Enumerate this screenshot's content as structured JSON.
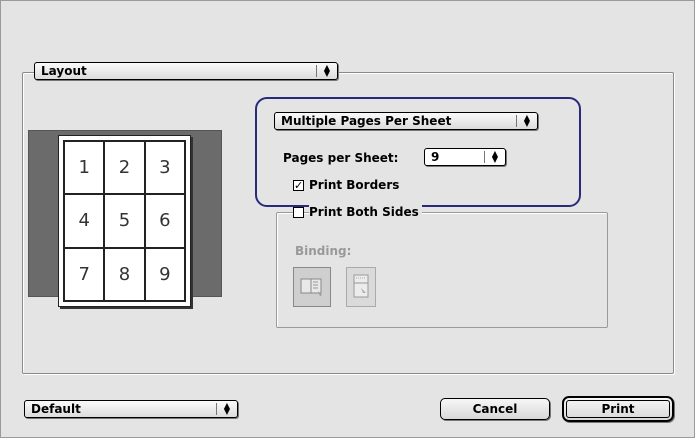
{
  "layout_popup": {
    "label": "Layout"
  },
  "preview": {
    "cells": [
      "1",
      "2",
      "3",
      "4",
      "5",
      "6",
      "7",
      "8",
      "9"
    ]
  },
  "multipage_popup": {
    "label": "Multiple Pages Per Sheet"
  },
  "pages_per_sheet": {
    "label": "Pages per Sheet:",
    "value": "9"
  },
  "print_borders": {
    "label": "Print Borders",
    "checked": true,
    "check_glyph": "✓"
  },
  "print_both_sides": {
    "label": "Print Both Sides",
    "checked": false
  },
  "binding": {
    "label": "Binding:",
    "options": [
      {
        "name": "long-edge-binding-icon",
        "selected": true
      },
      {
        "name": "short-edge-binding-icon",
        "selected": false
      }
    ]
  },
  "default_popup": {
    "label": "Default"
  },
  "buttons": {
    "cancel": "Cancel",
    "print": "Print"
  },
  "colors": {
    "highlight": "#2a2a7a",
    "preview_bg": "#6b6b6b"
  }
}
